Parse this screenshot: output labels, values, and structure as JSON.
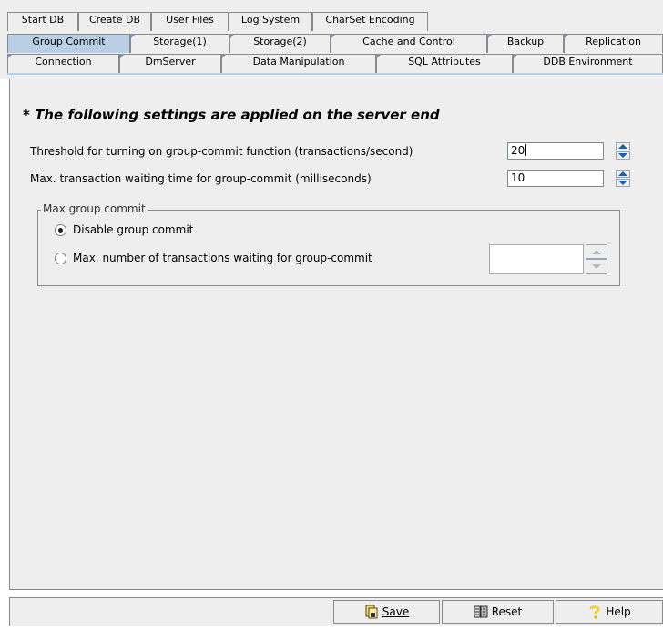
{
  "tabs": {
    "row1": [
      "Start DB",
      "Create DB",
      "User Files",
      "Log System",
      "CharSet Encoding"
    ],
    "row2": [
      "Group Commit",
      "Storage(1)",
      "Storage(2)",
      "Cache and Control",
      "Backup",
      "Replication"
    ],
    "row3": [
      "Connection",
      "DmServer",
      "Data Manipulation",
      "SQL Attributes",
      "DDB Environment"
    ],
    "selected": "Group Commit"
  },
  "heading": "* The following settings are applied on the server end",
  "settings": {
    "threshold_label": "Threshold for turning on group-commit function (transactions/second)",
    "threshold_value": "20",
    "max_wait_label": "Max. transaction waiting time for group-commit (milliseconds)",
    "max_wait_value": "10"
  },
  "group": {
    "title": "Max group commit",
    "option_disable": "Disable group commit",
    "option_max": "Max. number of transactions waiting for group-commit",
    "selected": "option_disable",
    "max_value": ""
  },
  "buttons": {
    "save": "Save",
    "reset": "Reset",
    "help": "Help"
  },
  "icons": [
    "save-icon",
    "reset-icon",
    "help-icon"
  ],
  "colors": {
    "selected_tab": "#b8cfe5",
    "panel": "#eeeeee",
    "spinner_arrow": "#1c5ea8"
  }
}
